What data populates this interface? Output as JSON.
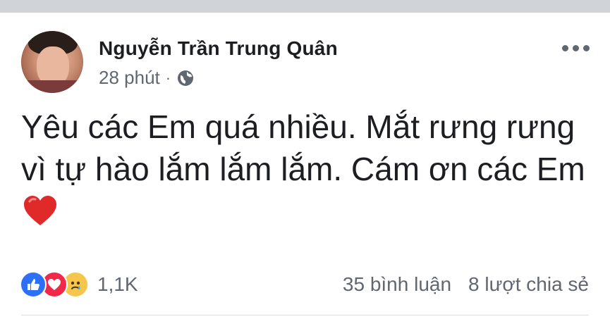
{
  "post": {
    "author": "Nguyễn Trần Trung Quân",
    "time": "28 phút",
    "separator": "·",
    "privacy_icon": "globe-icon",
    "text": "Yêu các Em quá nhiều. Mắt rưng rưng vì tự hào lắm lắm lắm. Cám ơn các Em",
    "emoji": "heart-emoji"
  },
  "reactions": {
    "icons": [
      "like-icon",
      "love-icon",
      "sad-icon"
    ],
    "count": "1,1K"
  },
  "stats": {
    "comments": "35 bình luận",
    "shares": "8 lượt chia sẻ"
  },
  "colors": {
    "like": "#2d6ff7",
    "love": "#f0284a",
    "sad": "#f6c64a",
    "text": "#1c1e21",
    "meta": "#606770"
  }
}
